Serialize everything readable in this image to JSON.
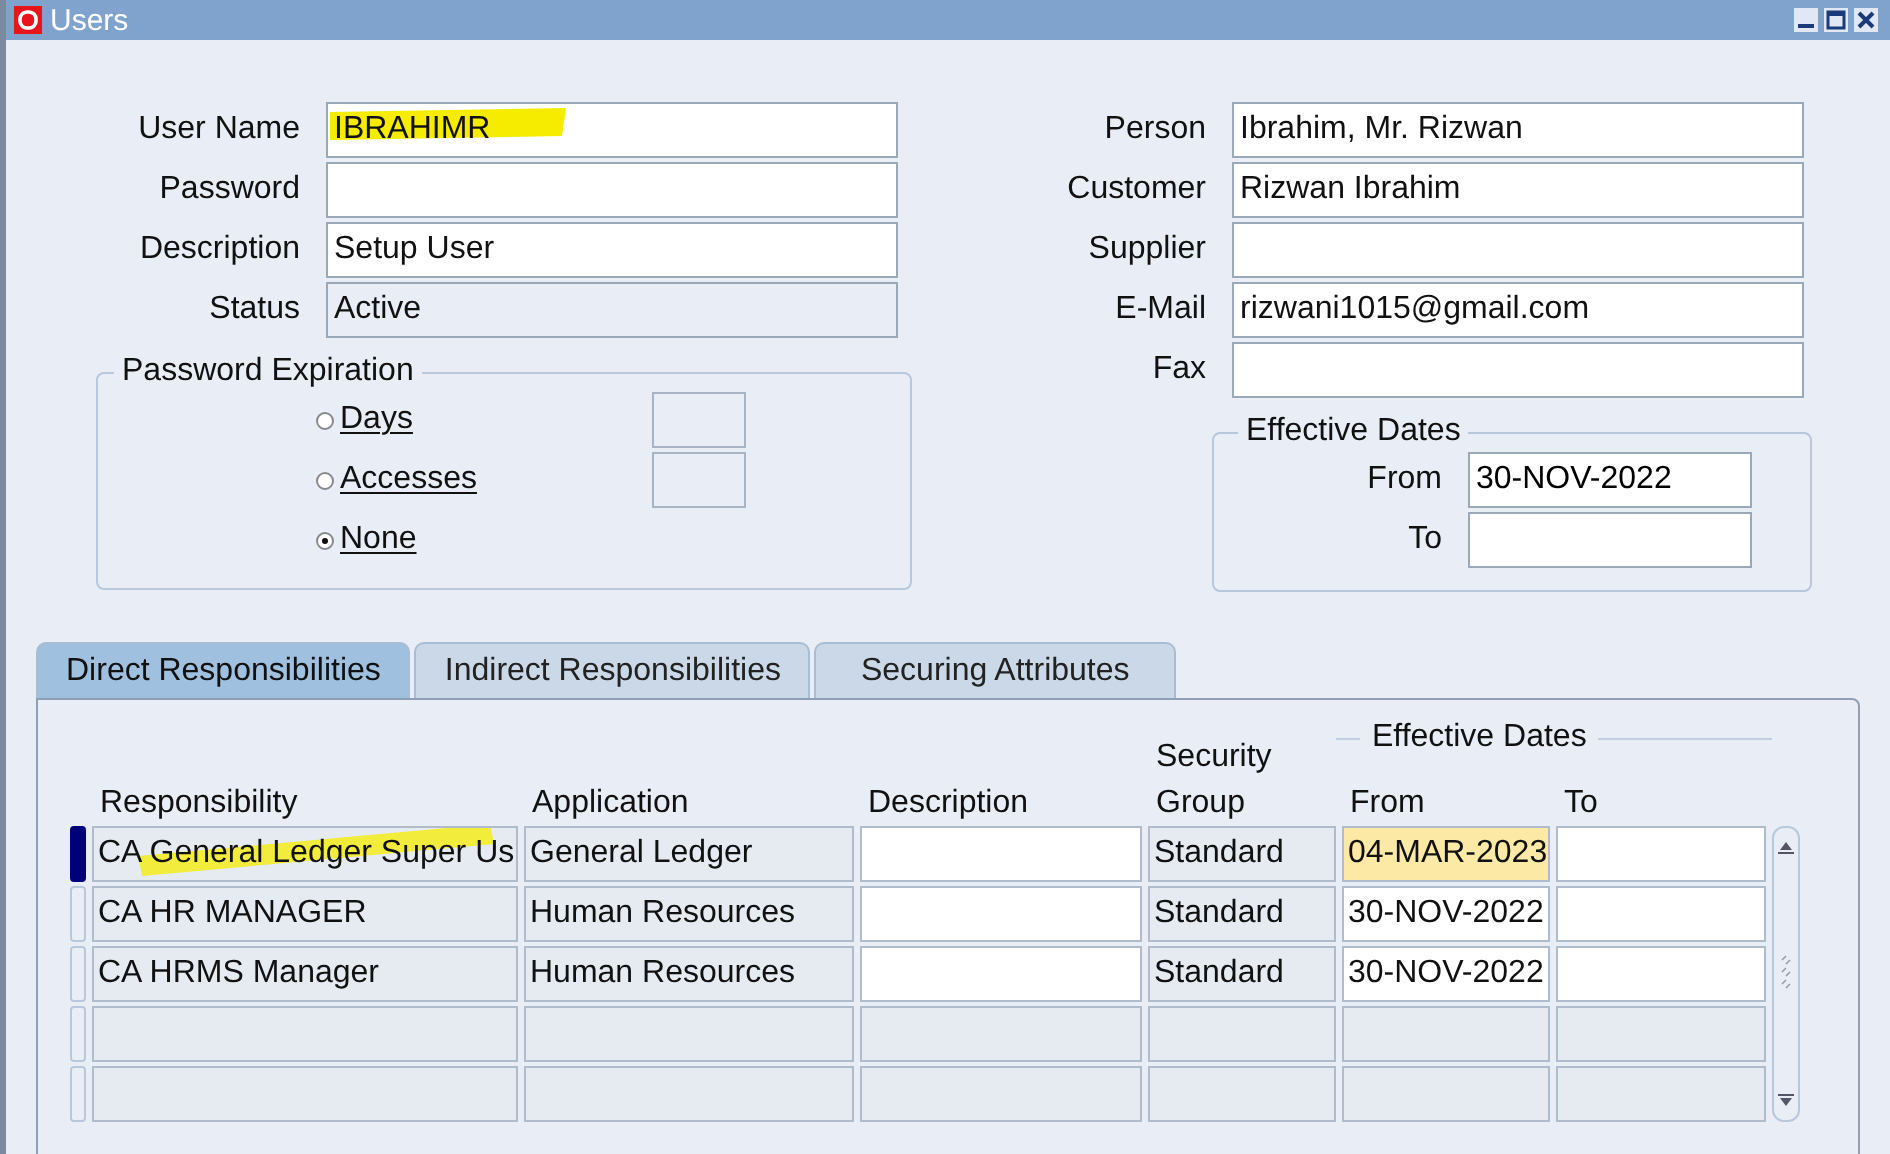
{
  "window": {
    "title": "Users"
  },
  "left_fields": [
    {
      "label": "User Name",
      "value": "IBRAHIMR",
      "disabled": false,
      "highlighted": true
    },
    {
      "label": "Password",
      "disabled": false
    },
    {
      "label": "Description",
      "value": "Setup User",
      "disabled": false
    },
    {
      "label": "Status",
      "value": "Active",
      "disabled": true
    }
  ],
  "password_expiration": {
    "title": "Password Expiration",
    "options": [
      {
        "label": "Days",
        "selected": false,
        "has_box": true
      },
      {
        "label": "Accesses",
        "selected": false,
        "has_box": true
      },
      {
        "label": "None",
        "selected": true,
        "has_box": false
      }
    ]
  },
  "right_fields": [
    {
      "label": "Person",
      "value": "Ibrahim, Mr. Rizwan"
    },
    {
      "label": "Customer",
      "value": "Rizwan Ibrahim"
    },
    {
      "label": "Supplier"
    },
    {
      "label": "E-Mail",
      "value": "rizwani1015@gmail.com"
    },
    {
      "label": "Fax"
    }
  ],
  "effective_dates": {
    "title": "Effective Dates",
    "from_label": "From",
    "from": "30-NOV-2022",
    "to_label": "To"
  },
  "tabs": [
    {
      "label": "Direct Responsibilities",
      "selected": true
    },
    {
      "label": "Indirect Responsibilities",
      "selected": false
    },
    {
      "label": "Securing Attributes",
      "selected": false
    }
  ],
  "table": {
    "group_heading": "Effective Dates",
    "columns": [
      "Responsibility",
      "Application",
      "Description",
      "Security\nGroup",
      "From",
      "To"
    ],
    "rows": [
      {
        "selected": true,
        "enabled": true,
        "highlighted": true,
        "responsibility": "CA General Ledger Super Us",
        "application": "General Ledger",
        "security_group": "Standard",
        "from": "04-MAR-2023"
      },
      {
        "selected": false,
        "enabled": true,
        "responsibility": "CA HR MANAGER",
        "application": "Human Resources",
        "security_group": "Standard",
        "from": "30-NOV-2022"
      },
      {
        "selected": false,
        "enabled": true,
        "responsibility": "CA HRMS Manager",
        "application": "Human Resources",
        "security_group": "Standard",
        "from": "30-NOV-2022"
      },
      {
        "selected": false,
        "enabled": false
      },
      {
        "selected": false,
        "enabled": false
      }
    ]
  }
}
